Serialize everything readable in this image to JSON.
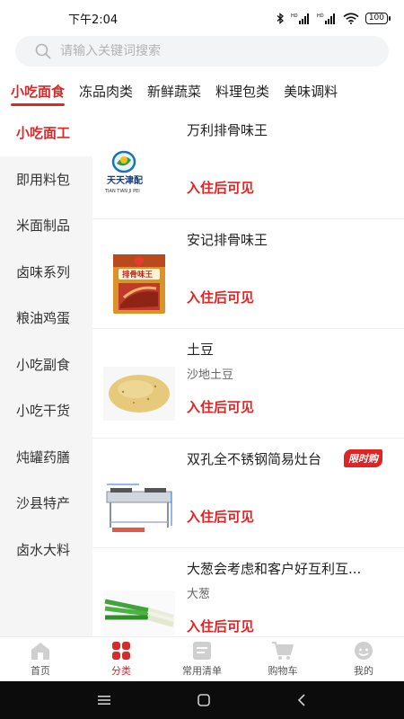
{
  "status_bar": {
    "time": "下午2:04",
    "battery": "100"
  },
  "search": {
    "placeholder": "请输入关键词搜索"
  },
  "top_tabs": [
    {
      "label": "小吃面食",
      "active": true
    },
    {
      "label": "冻品肉类",
      "active": false
    },
    {
      "label": "新鲜蔬菜",
      "active": false
    },
    {
      "label": "料理包类",
      "active": false
    },
    {
      "label": "美味调料",
      "active": false
    }
  ],
  "sidebar": {
    "items": [
      {
        "label": "小吃面工",
        "active": true
      },
      {
        "label": "即用料包",
        "active": false
      },
      {
        "label": "米面制品",
        "active": false
      },
      {
        "label": "卤味系列",
        "active": false
      },
      {
        "label": "粮油鸡蛋",
        "active": false
      },
      {
        "label": "小吃副食",
        "active": false
      },
      {
        "label": "小吃干货",
        "active": false
      },
      {
        "label": "炖罐药膳",
        "active": false
      },
      {
        "label": "沙县特产",
        "active": false
      },
      {
        "label": "卤水大料",
        "active": false
      }
    ]
  },
  "products": [
    {
      "name": "万利排骨味王",
      "subtitle": "",
      "price_text": "入住后可见",
      "badge": "",
      "image_text": "天天津配",
      "image_subtext": "TIAN TIAN JI PEI"
    },
    {
      "name": "安记排骨味王",
      "subtitle": "",
      "price_text": "入住后可见",
      "badge": "",
      "image_text": "排骨味王",
      "image_subtext": ""
    },
    {
      "name": "土豆",
      "subtitle": "沙地土豆",
      "price_text": "入住后可见",
      "badge": "",
      "image_text": "",
      "image_subtext": ""
    },
    {
      "name": "双孔全不锈钢简易灶台",
      "subtitle": "",
      "price_text": "入住后可见",
      "badge": "限时购",
      "image_text": "",
      "image_subtext": ""
    },
    {
      "name": "大葱会考虑和客户好互利互...",
      "subtitle": "大葱",
      "price_text": "入住后可见",
      "badge": "",
      "image_text": "",
      "image_subtext": ""
    }
  ],
  "bottom_nav": [
    {
      "label": "首页",
      "icon": "home-icon",
      "active": false
    },
    {
      "label": "分类",
      "icon": "category-icon",
      "active": true
    },
    {
      "label": "常用清单",
      "icon": "list-icon",
      "active": false
    },
    {
      "label": "购物车",
      "icon": "cart-icon",
      "active": false
    },
    {
      "label": "我的",
      "icon": "profile-icon",
      "active": false
    }
  ],
  "colors": {
    "accent": "#d62b2b",
    "price": "#e02424",
    "sidebar_bg": "#f5f5f5",
    "search_bg": "#f3f4f6"
  }
}
